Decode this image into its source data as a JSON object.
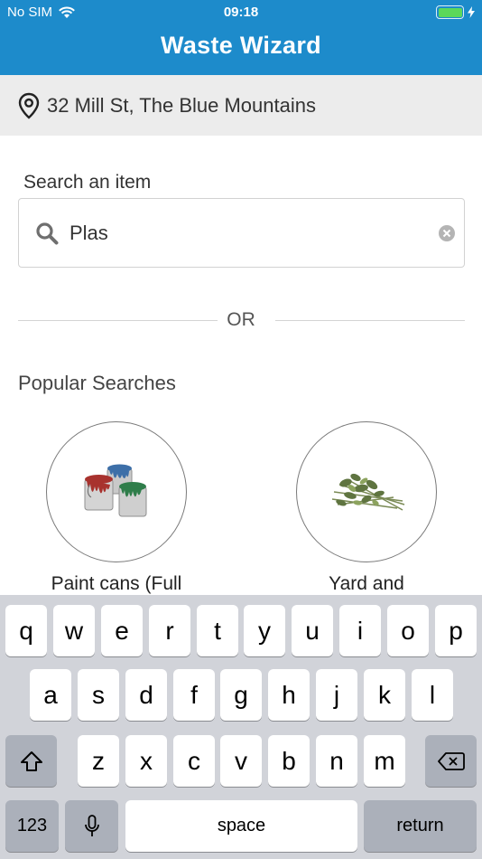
{
  "status_bar": {
    "carrier": "No SIM",
    "time": "09:18"
  },
  "header": {
    "title": "Waste Wizard"
  },
  "address": {
    "text": "32 Mill St, The Blue Mountains"
  },
  "search": {
    "label": "Search an item",
    "value": "Plas"
  },
  "divider": {
    "text": "OR"
  },
  "popular": {
    "heading": "Popular Searches",
    "items": [
      {
        "label": "Paint cans (Full"
      },
      {
        "label": "Yard and"
      }
    ]
  },
  "keyboard": {
    "row1": [
      "q",
      "w",
      "e",
      "r",
      "t",
      "y",
      "u",
      "i",
      "o",
      "p"
    ],
    "row2": [
      "a",
      "s",
      "d",
      "f",
      "g",
      "h",
      "j",
      "k",
      "l"
    ],
    "row3": [
      "z",
      "x",
      "c",
      "v",
      "b",
      "n",
      "m"
    ],
    "numbers_label": "123",
    "space_label": "space",
    "return_label": "return"
  }
}
